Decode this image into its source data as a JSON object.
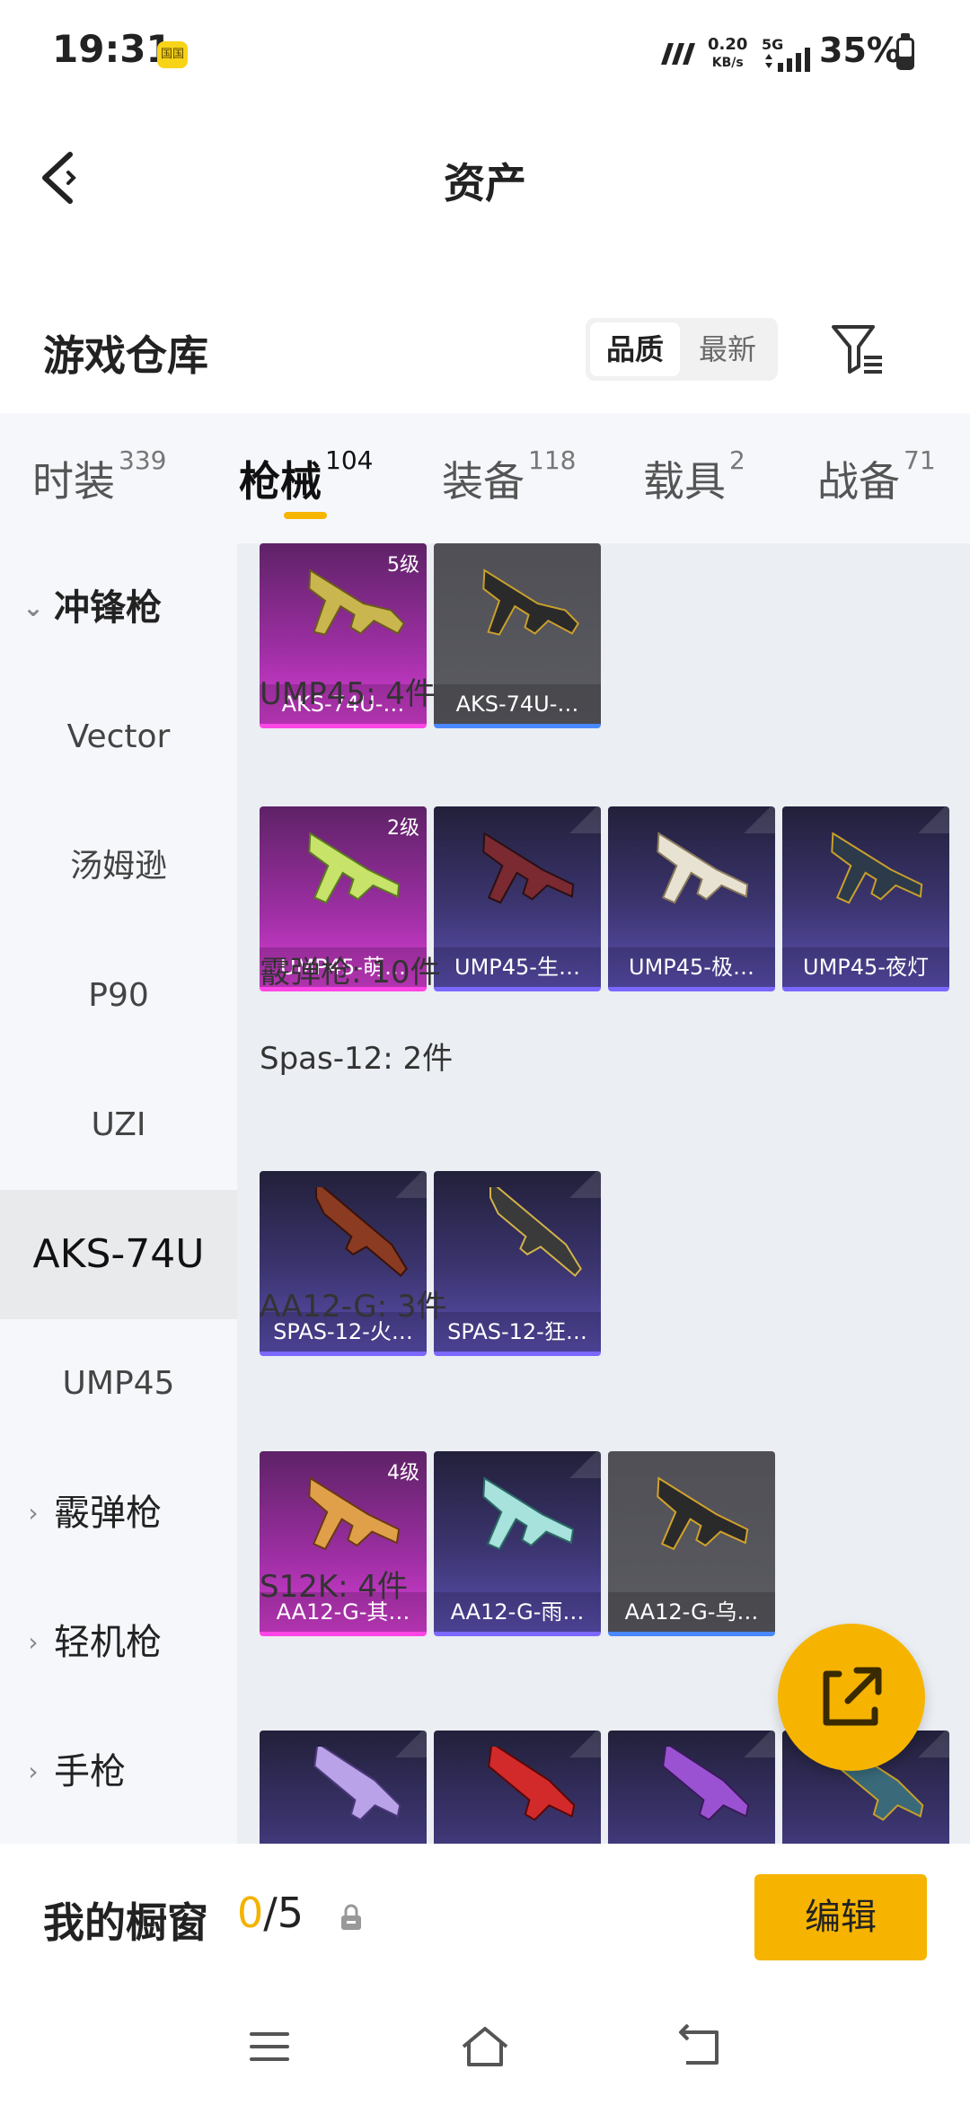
{
  "status_bar": {
    "time": "19:31",
    "notif_badge": "国国",
    "net_speed_value": "0.20",
    "net_speed_unit": "KB/s",
    "network_type": "5G",
    "battery_percent": "35%",
    "battery_level": 0.35
  },
  "header": {
    "title": "资产"
  },
  "warehouse": {
    "title": "游戏仓库",
    "sort_options": [
      "品质",
      "最新"
    ],
    "active_sort": "品质"
  },
  "tabs": [
    {
      "label": "时装",
      "count": "339"
    },
    {
      "label": "枪械",
      "count": "104",
      "active": true
    },
    {
      "label": "装备",
      "count": "118"
    },
    {
      "label": "载具",
      "count": "2"
    },
    {
      "label": "战备",
      "count": "71"
    }
  ],
  "sidebar": {
    "items": [
      {
        "label": "冲锋枪",
        "type": "group",
        "expanded": true
      },
      {
        "label": "Vector"
      },
      {
        "label": "汤姆逊"
      },
      {
        "label": "P90"
      },
      {
        "label": "UZI"
      },
      {
        "label": "AKS-74U",
        "selected": true
      },
      {
        "label": "UMP45"
      },
      {
        "label": "霰弹枪",
        "type": "group"
      },
      {
        "label": "轻机枪",
        "type": "group"
      },
      {
        "label": "手枪",
        "type": "group"
      }
    ]
  },
  "content": {
    "sections": [
      {
        "title": "",
        "cards": [
          {
            "name": "AKS-74U-…",
            "level": "5级",
            "rarity": "pink"
          },
          {
            "name": "AKS-74U-…",
            "rarity": "gray"
          }
        ]
      },
      {
        "title": "UMP45: 4件",
        "cards": [
          {
            "name": "UMP45-萌…",
            "level": "2级",
            "rarity": "pink"
          },
          {
            "name": "UMP45-生…",
            "rarity": "purple"
          },
          {
            "name": "UMP45-极…",
            "rarity": "purple"
          },
          {
            "name": "UMP45-夜灯",
            "rarity": "purple"
          }
        ]
      },
      {
        "title": "霰弹枪: 10件",
        "cards": []
      },
      {
        "title": "Spas-12: 2件",
        "cards": [
          {
            "name": "SPAS-12-火…",
            "rarity": "purple"
          },
          {
            "name": "SPAS-12-狂…",
            "rarity": "purple"
          }
        ]
      },
      {
        "title": "AA12-G: 3件",
        "cards": [
          {
            "name": "AA12-G-其…",
            "level": "4级",
            "rarity": "pink"
          },
          {
            "name": "AA12-G-雨…",
            "rarity": "purple"
          },
          {
            "name": "AA12-G-乌…",
            "rarity": "gray"
          }
        ]
      },
      {
        "title": "S12K: 4件",
        "cards": [
          {
            "name": "",
            "rarity": "purple"
          },
          {
            "name": "",
            "rarity": "purple"
          },
          {
            "name": "",
            "rarity": "purple"
          },
          {
            "name": "",
            "rarity": "purple"
          }
        ]
      }
    ]
  },
  "showcase": {
    "label": "我的橱窗",
    "used": "0",
    "total": "/5",
    "edit_label": "编辑"
  },
  "colors": {
    "accent": "#f6b400",
    "legendary_pink": "#ff46e6",
    "epic_purple": "#7a68ff",
    "rare_blue": "#4a88ff"
  },
  "icons": {
    "back": "back-arrow-icon",
    "filter": "filter-icon",
    "share": "share-icon",
    "lock": "lock-icon",
    "nav": [
      "menu-icon",
      "home-icon",
      "back-nav-icon"
    ]
  }
}
